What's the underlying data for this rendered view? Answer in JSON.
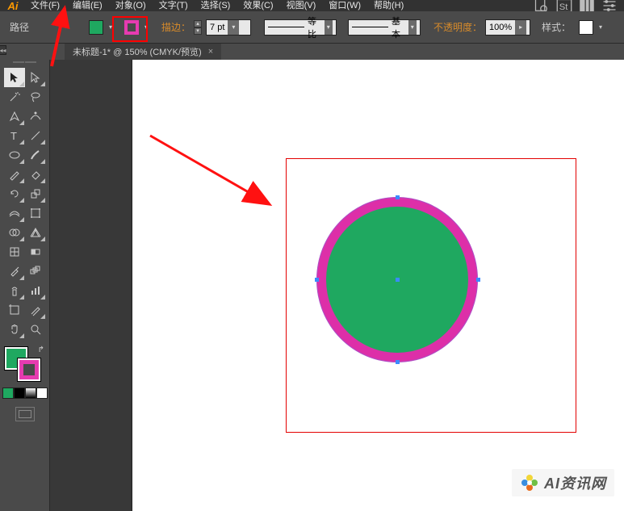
{
  "app": {
    "logo": "Ai"
  },
  "menu": {
    "file": "文件(F)",
    "edit": "编辑(E)",
    "object": "对象(O)",
    "type": "文字(T)",
    "select": "选择(S)",
    "effect": "效果(C)",
    "view": "视图(V)",
    "window": "窗口(W)",
    "help": "帮助(H)"
  },
  "control": {
    "selection_label": "路径",
    "fill_color": "#1fa860",
    "stroke_color": "#e63bb0",
    "stroke_label": "描边：",
    "stroke_weight": "7 pt",
    "profile_label": "等比",
    "brush_label": "基本",
    "opacity_label": "不透明度：",
    "opacity_value": "100%",
    "style_label": "样式："
  },
  "tab": {
    "title": "未标题-1* @ 150% (CMYK/预览)"
  },
  "tools": {
    "fill": "#1fa860",
    "stroke": "#e63bb0",
    "mini_colors": [
      "#1fa860",
      "#000000",
      "#333333",
      "#ffffff"
    ]
  },
  "canvas": {
    "artboard_border": "#e30000",
    "circle_fill": "#1fa860",
    "circle_stroke": "#dd2fa8"
  },
  "watermark": {
    "text": "AI资讯网"
  },
  "chart_data": null
}
